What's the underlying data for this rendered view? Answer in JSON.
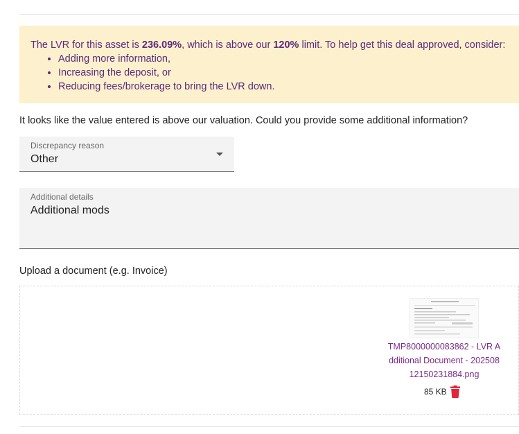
{
  "alert": {
    "lead": "The LVR for this asset is ",
    "lvr_value": "236.09%",
    "mid": ", which is above our ",
    "limit_value": "120%",
    "tail": " limit. To help get this deal approved, consider:",
    "items": [
      "Adding more information,",
      "Increasing the deposit, or",
      "Reducing fees/brokerage to bring the LVR down."
    ]
  },
  "prompt": "It looks like the value entered is above our valuation. Could you provide some additional information?",
  "discrepancy": {
    "label": "Discrepancy reason",
    "value": "Other"
  },
  "details": {
    "label": "Additional details",
    "value": "Additional mods"
  },
  "upload": {
    "label": "Upload a document (e.g. Invoice)",
    "file": {
      "name": "TMP8000000083862 - LVR Additional Document - 20250812150231884.png",
      "size": "85 KB"
    }
  },
  "colors": {
    "alert_bg": "#fdf0cd",
    "alert_text": "#5a2a7e",
    "file_link": "#7b2a8a",
    "delete": "#e0263a"
  },
  "icons": {
    "select_caret": "caret-down-icon",
    "delete": "trash-icon"
  }
}
